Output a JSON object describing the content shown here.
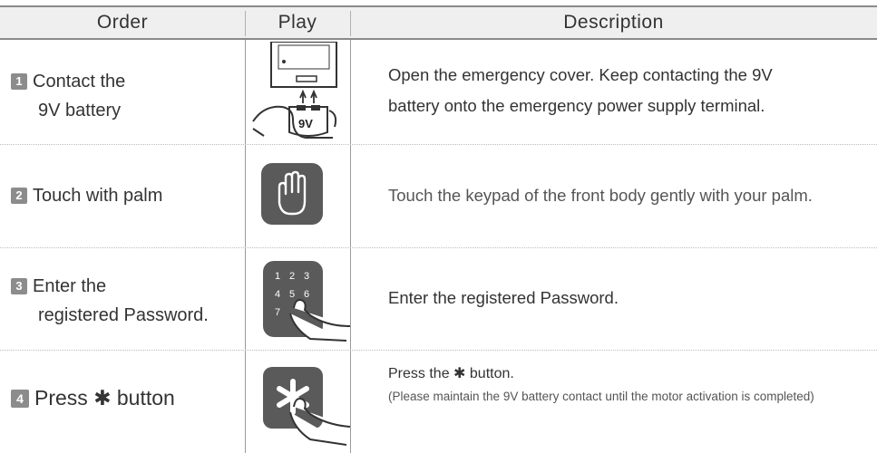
{
  "header": {
    "order": "Order",
    "play": "Play",
    "description": "Description"
  },
  "steps": [
    {
      "number": "1",
      "order_line1": "Contact the",
      "order_line2": "9V battery",
      "desc_line1": "Open the emergency cover. Keep contacting the 9V",
      "desc_line2": "battery onto the emergency power supply terminal.",
      "icon": "battery-contact-icon",
      "battery_label": "9V"
    },
    {
      "number": "2",
      "order_line1": "Touch with palm",
      "desc_line1": "Touch the keypad of the front body gently with your palm.",
      "icon": "palm-icon"
    },
    {
      "number": "3",
      "order_line1": "Enter the",
      "order_line2": "registered Password.",
      "desc_line1": "Enter the registered Password.",
      "icon": "keypad-icon",
      "keypad_digits": [
        "1",
        "2",
        "3",
        "4",
        "5",
        "6",
        "7"
      ]
    },
    {
      "number": "4",
      "order_prefix": "Press",
      "order_symbol": "✱",
      "order_suffix": "button",
      "desc_prefix": "Press the",
      "desc_symbol": "✱",
      "desc_suffix": "button.",
      "desc_note": "(Please maintain the 9V battery contact until the motor activation is completed)",
      "icon": "star-button-icon"
    }
  ],
  "colors": {
    "header_bg": "#efefef",
    "icon_tile": "#5a5a5a",
    "number_badge": "#8c8c8c"
  }
}
